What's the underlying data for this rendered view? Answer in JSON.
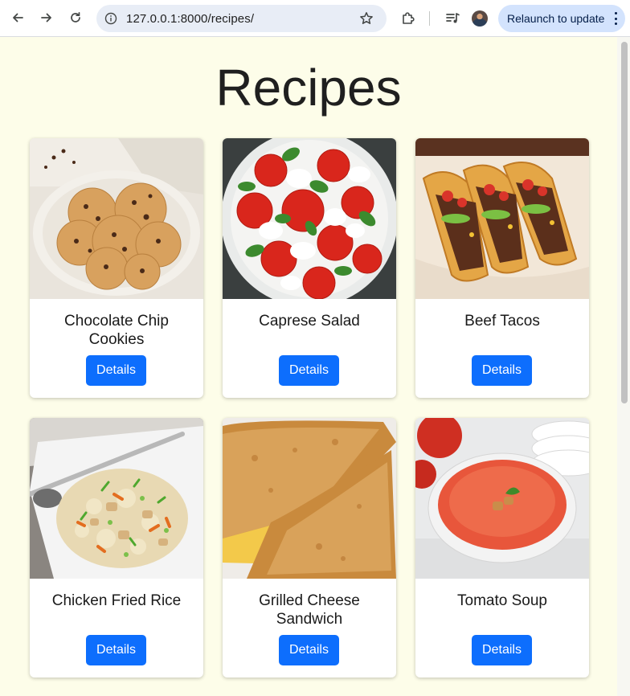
{
  "browser": {
    "url": "127.0.0.1:8000/recipes/",
    "relaunch_label": "Relaunch to update"
  },
  "page": {
    "title": "Recipes"
  },
  "recipes": [
    {
      "name": "Chocolate Chip Cookies",
      "button": "Details"
    },
    {
      "name": "Caprese Salad",
      "button": "Details"
    },
    {
      "name": "Beef Tacos",
      "button": "Details"
    },
    {
      "name": "Chicken Fried Rice",
      "button": "Details"
    },
    {
      "name": "Grilled Cheese Sandwich",
      "button": "Details"
    },
    {
      "name": "Tomato Soup",
      "button": "Details"
    }
  ],
  "colors": {
    "page_background": "#fdfde9",
    "button": "#0d6efd",
    "relaunch_pill": "#d3e3fd"
  }
}
